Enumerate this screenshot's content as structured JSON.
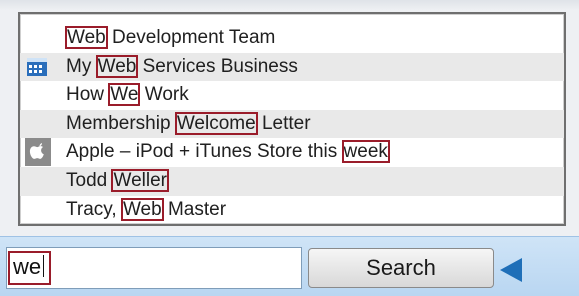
{
  "results": [
    {
      "pre": "",
      "match": "Web",
      "post": " Development Team",
      "icon": ""
    },
    {
      "pre": "My ",
      "match": "Web",
      "post": " Services Business",
      "icon": "calendar-icon"
    },
    {
      "pre": "How ",
      "match": "We",
      "post": " Work",
      "icon": ""
    },
    {
      "pre": "Membership ",
      "match": "Welcome",
      "post": " Letter",
      "icon": ""
    },
    {
      "pre": "Apple – iPod + iTunes Store this ",
      "match": "week",
      "post": "",
      "icon": "apple-icon"
    },
    {
      "pre": "Todd ",
      "match": "Weller",
      "post": "",
      "icon": ""
    },
    {
      "pre": "Tracy, ",
      "match": "Web",
      "post": " Master",
      "icon": ""
    }
  ],
  "search": {
    "value": "we",
    "button_label": "Search",
    "arrow_icon": "left-arrow-icon"
  },
  "colors": {
    "highlight": "#9a1c2a",
    "accent": "#1f6fb8"
  }
}
